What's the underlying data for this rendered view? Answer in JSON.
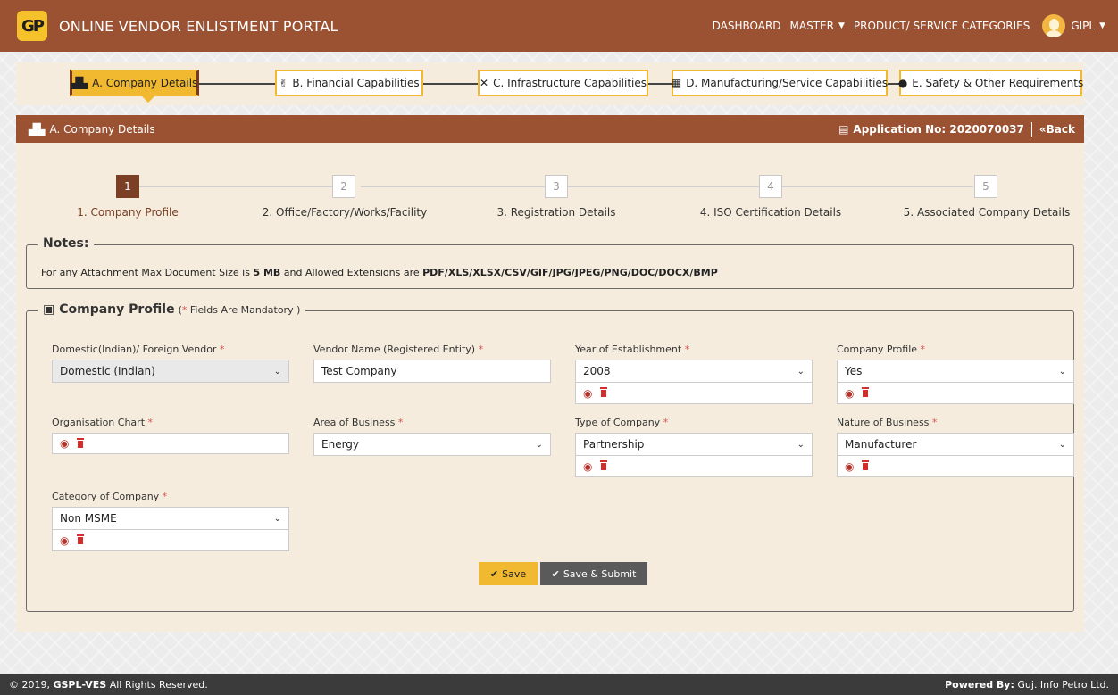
{
  "header": {
    "logo_text": "GP",
    "title": "ONLINE VENDOR ENLISTMENT PORTAL",
    "nav": [
      "DASHBOARD",
      "MASTER",
      "PRODUCT/ SERVICE CATEGORIES"
    ],
    "user": "GIPL"
  },
  "tabs": [
    {
      "label": "A. Company Details",
      "icon": "factory-icon"
    },
    {
      "label": "B. Financial Capabilities",
      "icon": "finance-icon"
    },
    {
      "label": "C. Infrastructure Capabilities",
      "icon": "tools-icon"
    },
    {
      "label": "D. Manufacturing/Service Capabilities",
      "icon": "building-icon"
    },
    {
      "label": "E. Safety & Other Requirements",
      "icon": "alert-icon"
    }
  ],
  "panel": {
    "title": "A. Company Details",
    "application_label": "Application No: 2020070037",
    "back_label": "Back"
  },
  "wizard": {
    "steps": [
      {
        "num": "1",
        "label": "1. Company Profile"
      },
      {
        "num": "2",
        "label": "2. Office/Factory/Works/Facility"
      },
      {
        "num": "3",
        "label": "3. Registration Details"
      },
      {
        "num": "4",
        "label": "4. ISO Certification Details"
      },
      {
        "num": "5",
        "label": "5. Associated Company Details"
      }
    ]
  },
  "notes": {
    "title": "Notes:",
    "prefix": "For any Attachment Max Document Size is ",
    "size": "5 MB",
    "middle": " and Allowed Extensions are ",
    "extensions": "PDF/XLS/XLSX/CSV/GIF/JPG/JPEG/PNG/DOC/DOCX/BMP"
  },
  "profile": {
    "title": "Company Profile",
    "mandatory_open": "(",
    "mandatory_star": "*",
    "mandatory_text": " Fields Are Mandatory )",
    "fields": {
      "vendor_type": {
        "label": "Domestic(Indian)/ Foreign Vendor ",
        "value": "Domestic (Indian)"
      },
      "vendor_name": {
        "label": "Vendor Name (Registered Entity) ",
        "value": "Test Company"
      },
      "year": {
        "label": "Year of Establishment ",
        "value": "2008"
      },
      "company_profile": {
        "label": "Company Profile ",
        "value": "Yes"
      },
      "org_chart": {
        "label": "Organisation Chart "
      },
      "area": {
        "label": "Area of Business ",
        "value": "Energy"
      },
      "type": {
        "label": "Type of Company ",
        "value": "Partnership"
      },
      "nature": {
        "label": "Nature of Business ",
        "value": "Manufacturer"
      },
      "category": {
        "label": "Category of Company ",
        "value": "Non MSME"
      }
    },
    "star": "*"
  },
  "buttons": {
    "save": "Save",
    "submit": "Save & Submit"
  },
  "footer": {
    "left_pre": "© 2019, ",
    "left_brand": "GSPL-VES",
    "left_post": " All Rights Reserved.",
    "right_pre": "Powered By:",
    "right_post": " Guj. Info Petro Ltd."
  }
}
